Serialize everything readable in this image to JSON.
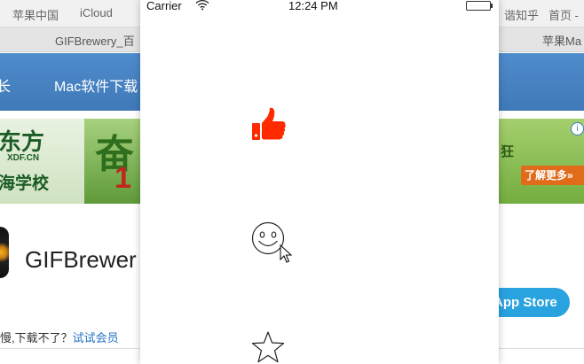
{
  "bookmarks": [
    "苹果中国",
    "iCloud",
    "谐知乎",
    "首页 -"
  ],
  "tabs": [
    "GIFBrewery_百",
    "苹果Ma"
  ],
  "site_nav": [
    "长",
    "Mac软件下载"
  ],
  "ad": {
    "left_line1": "东方",
    "left_line2": "XDF.CN",
    "left_line3": "海学校",
    "mid_char": "奋",
    "right_text": "狂",
    "button": "了解更多»",
    "info": "i"
  },
  "app": {
    "title": "GIFBrewer",
    "store_button": "App Store"
  },
  "slow": {
    "text": "慢,下载不了？",
    "link": "试试会员"
  },
  "phone": {
    "status": {
      "carrier": "Carrier",
      "time": "12:24 PM"
    },
    "icons": [
      "thumbs-up",
      "smiley",
      "star"
    ],
    "colors": {
      "thumb": "#ff2a00"
    }
  }
}
